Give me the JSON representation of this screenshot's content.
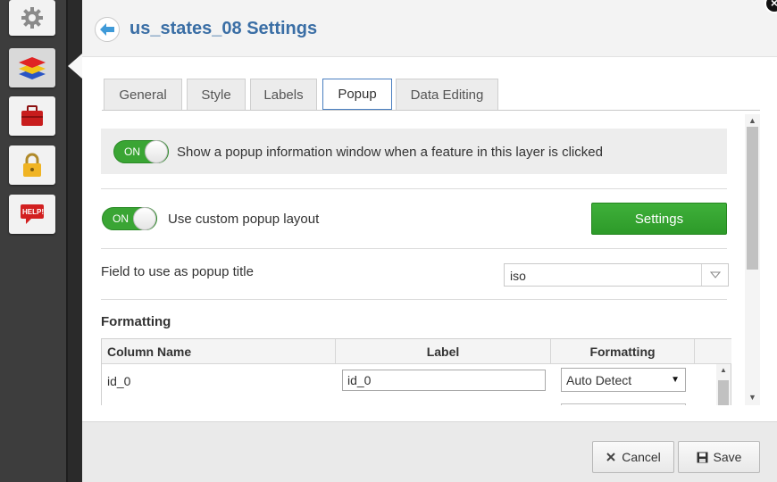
{
  "sidebar": {
    "items": [
      {
        "icon": "gear-icon"
      },
      {
        "icon": "layers-icon"
      },
      {
        "icon": "toolbox-icon"
      },
      {
        "icon": "lock-icon"
      },
      {
        "icon": "help-icon",
        "label": "HELP!"
      }
    ]
  },
  "dialog": {
    "title": "us_states_08 Settings",
    "close_symbol": "×"
  },
  "tabs": [
    {
      "label": "General"
    },
    {
      "label": "Style"
    },
    {
      "label": "Labels"
    },
    {
      "label": "Popup",
      "active": true
    },
    {
      "label": "Data Editing"
    }
  ],
  "popup": {
    "show_toggle": {
      "state": "ON",
      "label": "Show a popup information window when a feature in this layer is clicked"
    },
    "custom_toggle": {
      "state": "ON",
      "label": "Use custom popup layout"
    },
    "settings_button": "Settings",
    "title_field": {
      "label": "Field to use as popup title",
      "value": "iso"
    },
    "formatting": {
      "title": "Formatting",
      "columns": [
        "Column Name",
        "Label",
        "Formatting"
      ],
      "rows": [
        {
          "column_name": "id_0",
          "label": "id_0",
          "formatting": "Auto Detect"
        }
      ]
    }
  },
  "footer": {
    "cancel_label": "Cancel",
    "save_label": "Save"
  },
  "colors": {
    "accent": "#3a6ea5",
    "toggle_on": "#3aa534",
    "settings_button": "#2d9a29"
  }
}
